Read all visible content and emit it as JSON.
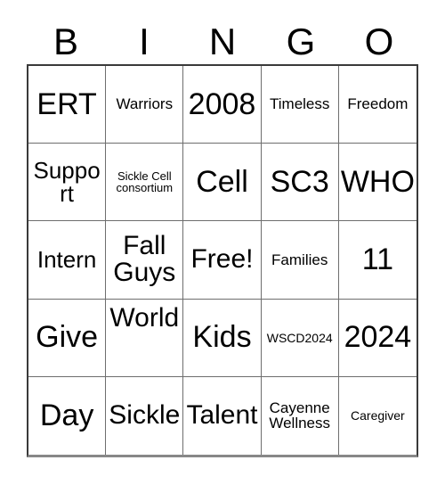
{
  "card": {
    "title": "BINGO",
    "headers": [
      "B",
      "I",
      "N",
      "G",
      "O"
    ],
    "rows": [
      [
        {
          "text": "ERT",
          "size": "fs-xl"
        },
        {
          "text": "Warriors",
          "size": "fs-sm"
        },
        {
          "text": "2008",
          "size": "fs-xl"
        },
        {
          "text": "Timeless",
          "size": "fs-sm"
        },
        {
          "text": "Freedom",
          "size": "fs-sm"
        }
      ],
      [
        {
          "text": "Support",
          "size": "fs-md"
        },
        {
          "text": "Sickle Cell\nconsortium",
          "size": "fs-xxs"
        },
        {
          "text": "Cell",
          "size": "fs-xl"
        },
        {
          "text": "SC3",
          "size": "fs-xl"
        },
        {
          "text": "WHO",
          "size": "fs-xl"
        }
      ],
      [
        {
          "text": "Intern",
          "size": "fs-md"
        },
        {
          "text": "Fall Guys",
          "size": "fs-lg"
        },
        {
          "text": "Free!",
          "size": "fs-lg"
        },
        {
          "text": "Families",
          "size": "fs-sm"
        },
        {
          "text": "11",
          "size": "fs-xl"
        }
      ],
      [
        {
          "text": "Give",
          "size": "fs-xl"
        },
        {
          "text": "World\n",
          "size": "fs-lg",
          "align": "top"
        },
        {
          "text": "Kids",
          "size": "fs-xl"
        },
        {
          "text": "WSCD2024",
          "size": "fs-xs"
        },
        {
          "text": "2024",
          "size": "fs-xl"
        }
      ],
      [
        {
          "text": "Day",
          "size": "fs-xl"
        },
        {
          "text": "Sickle",
          "size": "fs-lg"
        },
        {
          "text": "Talent",
          "size": "fs-lg"
        },
        {
          "text": "Cayenne\nWellness",
          "size": "fs-sm"
        },
        {
          "text": "Caregiver",
          "size": "fs-xs"
        }
      ]
    ]
  },
  "colors": {
    "text": "#000000",
    "background": "#ffffff",
    "grid_line": "#6e6e6e",
    "outer_border": "#3a3a3a"
  }
}
